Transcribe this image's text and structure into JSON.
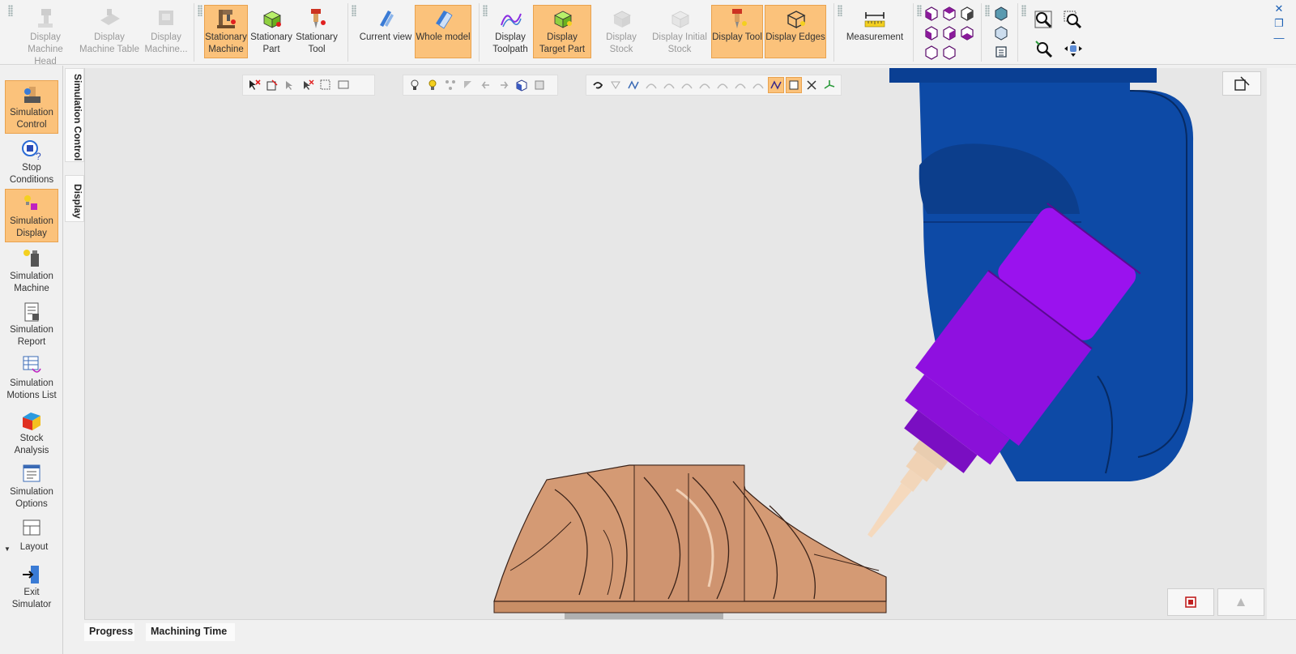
{
  "ribbon": {
    "machine_group": {
      "display_machine_head": "Display Machine Head",
      "display_machine_table": "Display Machine Table",
      "display_machine": "Display Machine..."
    },
    "stationary_group": {
      "stationary_machine": "Stationary Machine",
      "stationary_part": "Stationary Part",
      "stationary_tool": "Stationary Tool"
    },
    "view_group": {
      "current_view": "Current view",
      "whole_model": "Whole model"
    },
    "display_group": {
      "display_toolpath": "Display Toolpath",
      "display_target_part": "Display Target Part",
      "display_stock": "Display Stock",
      "display_initial_stock": "Display Initial Stock",
      "display_tool": "Display Tool",
      "display_edges": "Display Edges"
    },
    "measure_group": {
      "measurement": "Measurement"
    }
  },
  "window_controls": {
    "close": "✕",
    "restore": "❐",
    "minimize": "—"
  },
  "left_panel": {
    "simulation_control": "Simulation Control",
    "stop_conditions": "Stop Conditions",
    "simulation_display": "Simulation Display",
    "simulation_machine": "Simulation Machine",
    "simulation_report": "Simulation Report",
    "simulation_motions_list": "Simulation Motions List",
    "stock_analysis": "Stock Analysis",
    "simulation_options": "Simulation Options",
    "layout": "Layout",
    "exit_simulator": "Exit Simulator"
  },
  "vertical_tabs": {
    "simulation_control": "Simulation Control",
    "display": "Display"
  },
  "bottom_tabs": {
    "progress": "Progress",
    "machining_time": "Machining Time"
  },
  "colors": {
    "active_button": "#fbc27b",
    "spindle_head": "#0d4aa6",
    "tool_holder": "#9a12ee",
    "part": "#d49a74"
  }
}
